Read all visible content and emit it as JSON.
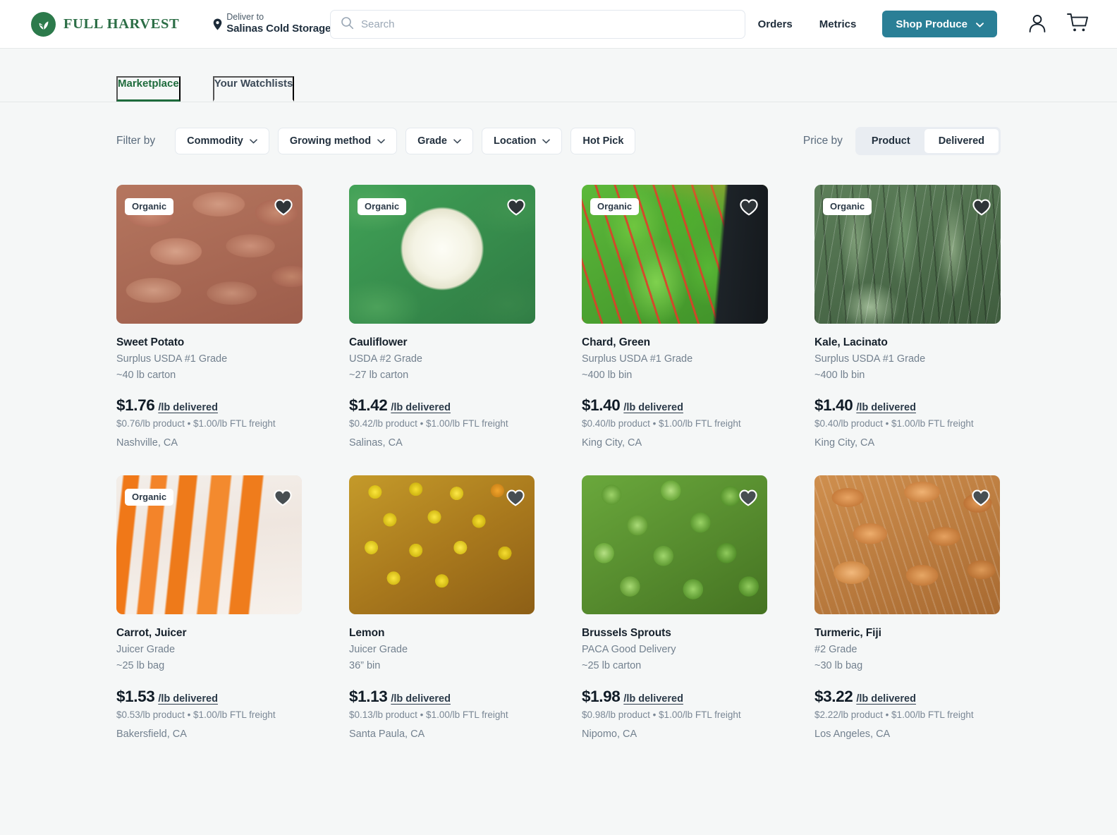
{
  "header": {
    "logo_text": "FULL HARVEST",
    "logo_icon": "leaf-sprout-icon",
    "deliver_label": "Deliver to",
    "deliver_value": "Salinas Cold Storage",
    "search_placeholder": "Search",
    "search_value": "",
    "nav": [
      {
        "label": "Orders"
      },
      {
        "label": "Metrics"
      }
    ],
    "shop_button": "Shop Produce",
    "account_icon": "user-icon",
    "cart_icon": "cart-icon"
  },
  "tabs": [
    {
      "label": "Marketplace",
      "active": true
    },
    {
      "label": "Your Watchlists",
      "active": false
    }
  ],
  "filters": {
    "label": "Filter by",
    "chips": [
      {
        "label": "Commodity",
        "has_chevron": true
      },
      {
        "label": "Growing method",
        "has_chevron": true
      },
      {
        "label": "Grade",
        "has_chevron": true
      },
      {
        "label": "Location",
        "has_chevron": true
      },
      {
        "label": "Hot Pick",
        "has_chevron": false
      }
    ],
    "price_by_label": "Price by",
    "price_by_options": [
      {
        "label": "Product",
        "active": false
      },
      {
        "label": "Delivered",
        "active": true
      }
    ]
  },
  "colors": {
    "brand_green": "#2c7a4b",
    "tab_active": "#1e6b3c",
    "shop_button": "#2a7f96",
    "page_bg": "#f5f7f7",
    "muted_text": "#73818f"
  },
  "products": [
    {
      "name": "Sweet Potato",
      "grade": "Surplus USDA #1 Grade",
      "pack": "~40 lb carton",
      "price": "$1.76",
      "unit": "/lb delivered",
      "breakdown": "$0.76/lb product • $1.00/lb FTL freight",
      "location": "Nashville, CA",
      "organic": true,
      "organic_label": "Organic",
      "favorited": false,
      "photo": "ph-sweetpotato"
    },
    {
      "name": "Cauliflower",
      "grade": "USDA #2 Grade",
      "pack": "~27 lb carton",
      "price": "$1.42",
      "unit": "/lb delivered",
      "breakdown": "$0.42/lb product • $1.00/lb FTL freight",
      "location": "Salinas, CA",
      "organic": true,
      "organic_label": "Organic",
      "favorited": false,
      "photo": "ph-cauliflower"
    },
    {
      "name": "Chard, Green",
      "grade": "Surplus USDA #1 Grade",
      "pack": "~400 lb bin",
      "price": "$1.40",
      "unit": "/lb delivered",
      "breakdown": "$0.40/lb product • $1.00/lb FTL freight",
      "location": "King City, CA",
      "organic": true,
      "organic_label": "Organic",
      "favorited": false,
      "photo": "ph-chard"
    },
    {
      "name": "Kale, Lacinato",
      "grade": "Surplus USDA #1 Grade",
      "pack": "~400 lb bin",
      "price": "$1.40",
      "unit": "/lb delivered",
      "breakdown": "$0.40/lb product • $1.00/lb FTL freight",
      "location": "King City, CA",
      "organic": true,
      "organic_label": "Organic",
      "favorited": false,
      "photo": "ph-kale"
    },
    {
      "name": "Carrot, Juicer",
      "grade": "Juicer Grade",
      "pack": "~25 lb bag",
      "price": "$1.53",
      "unit": "/lb delivered",
      "breakdown": "$0.53/lb product • $1.00/lb FTL freight",
      "location": "Bakersfield, CA",
      "organic": true,
      "organic_label": "Organic",
      "favorited": false,
      "photo": "ph-carrot"
    },
    {
      "name": "Lemon",
      "grade": "Juicer Grade",
      "pack": "36” bin",
      "price": "$1.13",
      "unit": "/lb delivered",
      "breakdown": "$0.13/lb product • $1.00/lb FTL freight",
      "location": "Santa Paula, CA",
      "organic": false,
      "organic_label": "",
      "favorited": false,
      "photo": "ph-lemon"
    },
    {
      "name": "Brussels Sprouts",
      "grade": "PACA Good Delivery",
      "pack": "~25 lb carton",
      "price": "$1.98",
      "unit": "/lb delivered",
      "breakdown": "$0.98/lb product • $1.00/lb FTL freight",
      "location": "Nipomo, CA",
      "organic": false,
      "organic_label": "",
      "favorited": false,
      "photo": "ph-sprouts"
    },
    {
      "name": "Turmeric, Fiji",
      "grade": "#2 Grade",
      "pack": "~30 lb bag",
      "price": "$3.22",
      "unit": "/lb delivered",
      "breakdown": "$2.22/lb product • $1.00/lb FTL freight",
      "location": "Los Angeles, CA",
      "organic": false,
      "organic_label": "",
      "favorited": false,
      "photo": "ph-turmeric"
    }
  ]
}
